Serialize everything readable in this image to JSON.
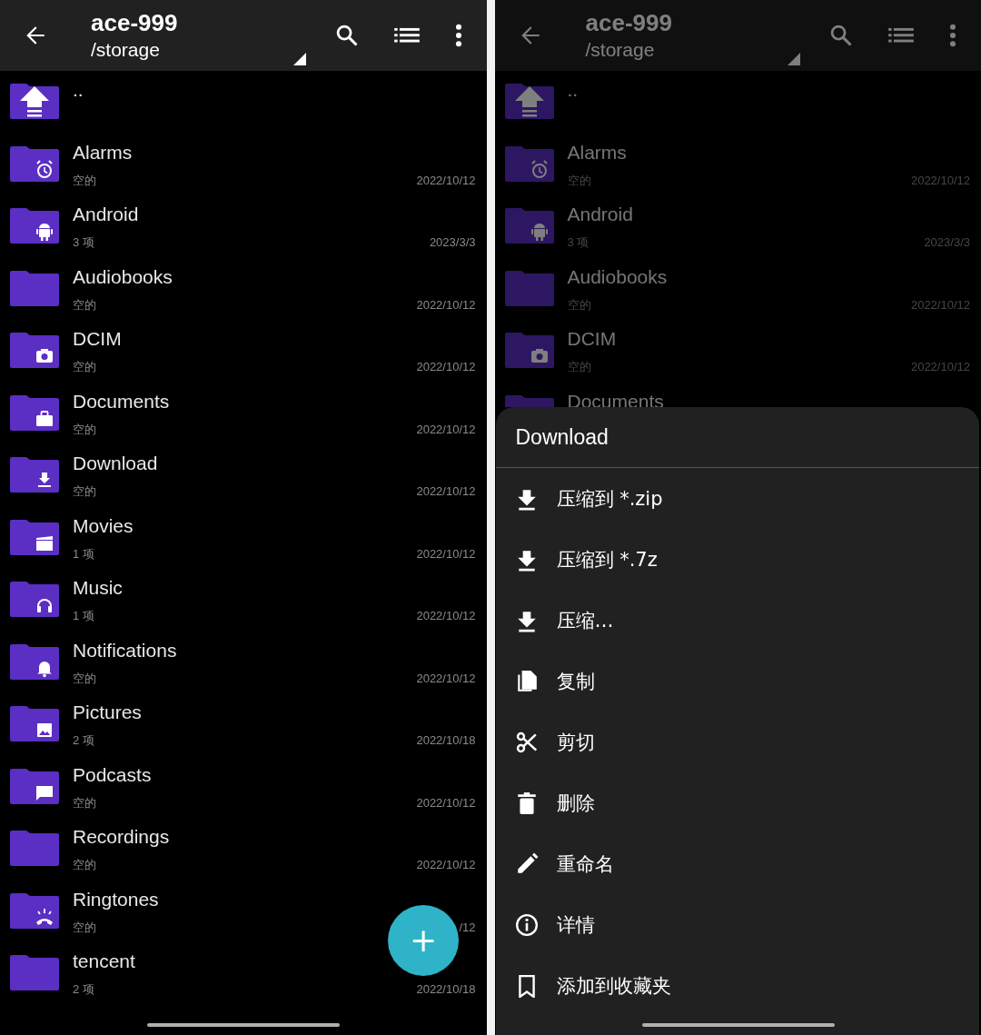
{
  "panels": [
    {
      "header": {
        "title": "ace-999",
        "path": "/storage"
      },
      "dimmed": false,
      "items": [
        {
          "kind": "parent",
          "name": ".."
        },
        {
          "kind": "folder",
          "name": "Alarms",
          "info": "空的",
          "date": "2022/10/12"
        },
        {
          "kind": "folder",
          "name": "Android",
          "info": "3 项",
          "date": "2023/3/3"
        },
        {
          "kind": "folder",
          "name": "Audiobooks",
          "info": "空的",
          "date": "2022/10/12"
        },
        {
          "kind": "folder",
          "name": "DCIM",
          "info": "空的",
          "date": "2022/10/12"
        },
        {
          "kind": "folder",
          "name": "Documents",
          "info": "空的",
          "date": "2022/10/12"
        },
        {
          "kind": "folder",
          "name": "Download",
          "info": "空的",
          "date": "2022/10/12"
        },
        {
          "kind": "folder",
          "name": "Movies",
          "info": "1 项",
          "date": "2022/10/12"
        },
        {
          "kind": "folder",
          "name": "Music",
          "info": "1 项",
          "date": "2022/10/12"
        },
        {
          "kind": "folder",
          "name": "Notifications",
          "info": "空的",
          "date": "2022/10/12"
        },
        {
          "kind": "folder",
          "name": "Pictures",
          "info": "2 项",
          "date": "2022/10/18"
        },
        {
          "kind": "folder",
          "name": "Podcasts",
          "info": "空的",
          "date": "2022/10/12"
        },
        {
          "kind": "folder",
          "name": "Recordings",
          "info": "空的",
          "date": "2022/10/12"
        },
        {
          "kind": "folder",
          "name": "Ringtones",
          "info": "空的",
          "date": "/12"
        },
        {
          "kind": "folder",
          "name": "tencent",
          "info": "2 项",
          "date": "2022/10/18"
        }
      ],
      "fab": {
        "label": "+"
      }
    },
    {
      "header": {
        "title": "ace-999",
        "path": "/storage"
      },
      "dimmed": true,
      "items": [
        {
          "kind": "parent",
          "name": ".."
        },
        {
          "kind": "folder",
          "name": "Alarms",
          "info": "空的",
          "date": "2022/10/12"
        },
        {
          "kind": "folder",
          "name": "Android",
          "info": "3 项",
          "date": "2023/3/3"
        },
        {
          "kind": "folder",
          "name": "Audiobooks",
          "info": "空的",
          "date": "2022/10/12"
        },
        {
          "kind": "folder",
          "name": "DCIM",
          "info": "空的",
          "date": "2022/10/12"
        },
        {
          "kind": "folder",
          "name": "Documents"
        }
      ],
      "sheet": {
        "title": "Download",
        "actions": [
          "压缩到 *.zip",
          "压缩到 *.7z",
          "压缩…",
          "复制",
          "剪切",
          "删除",
          "重命名",
          "详情",
          "添加到收藏夹"
        ]
      }
    }
  ]
}
